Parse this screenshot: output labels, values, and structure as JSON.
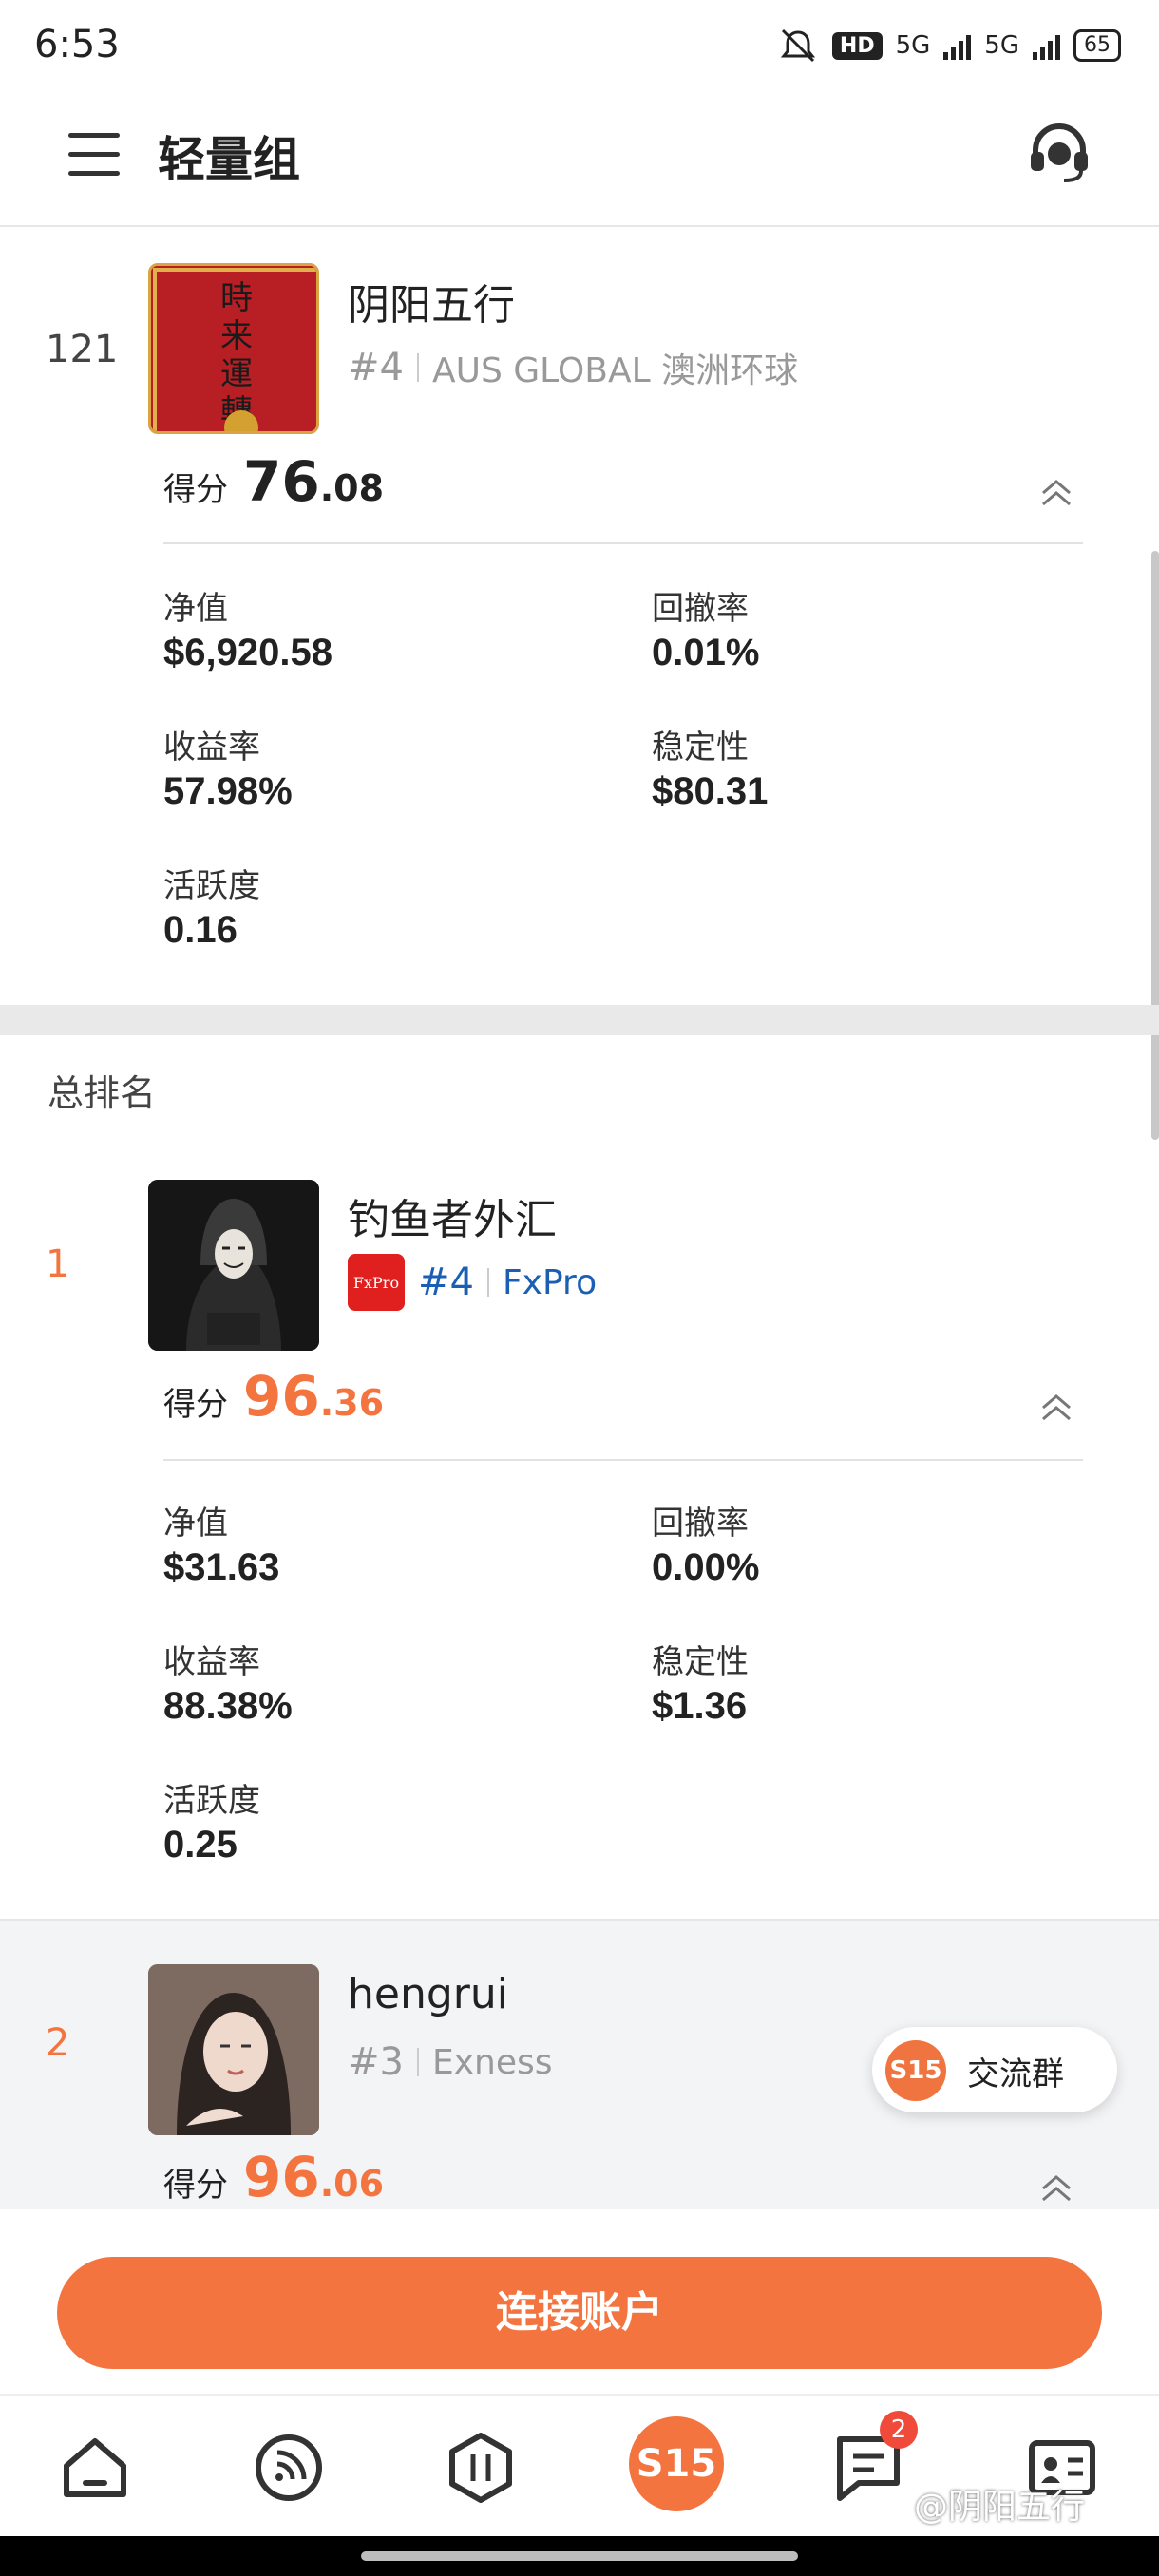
{
  "status_bar": {
    "time": "6:53",
    "hd": "HD",
    "net1": "5G",
    "net2": "5G",
    "battery": "65"
  },
  "app_bar": {
    "title": "轻量组"
  },
  "cards": [
    {
      "rank": "121",
      "name": "阴阳五行",
      "rank_tag": "#4",
      "broker": "AUS GLOBAL 澳洲环球",
      "score_label": "得分",
      "score_int": "76",
      "score_dec": ".08",
      "stats": {
        "equity_label": "净值",
        "equity": "$6,920.58",
        "drawdown_label": "回撤率",
        "drawdown": "0.01%",
        "return_label": "收益率",
        "return": "57.98%",
        "stability_label": "稳定性",
        "stability": "$80.31",
        "activity_label": "活跃度",
        "activity": "0.16"
      }
    },
    {
      "rank": "1",
      "name": "钓鱼者外汇",
      "broker_logo": "FxPro",
      "rank_tag": "#4",
      "broker": "FxPro",
      "score_label": "得分",
      "score_int": "96",
      "score_dec": ".36",
      "stats": {
        "equity_label": "净值",
        "equity": "$31.63",
        "drawdown_label": "回撤率",
        "drawdown": "0.00%",
        "return_label": "收益率",
        "return": "88.38%",
        "stability_label": "稳定性",
        "stability": "$1.36",
        "activity_label": "活跃度",
        "activity": "0.25"
      }
    },
    {
      "rank": "2",
      "name": "hengrui",
      "rank_tag": "#3",
      "broker": "Exness",
      "score_label": "得分",
      "score_int": "96",
      "score_dec": ".06"
    }
  ],
  "section": {
    "overall_title": "总排名"
  },
  "floating": {
    "logo": "S15",
    "label": "交流群"
  },
  "connect_button": "连接账户",
  "tabbar": {
    "center_logo": "S15",
    "badge_count": "2"
  },
  "watermark": "@阴阳五行",
  "colors": {
    "accent": "#f47440",
    "blue": "#1a5fb4",
    "gray_text": "#999999"
  }
}
